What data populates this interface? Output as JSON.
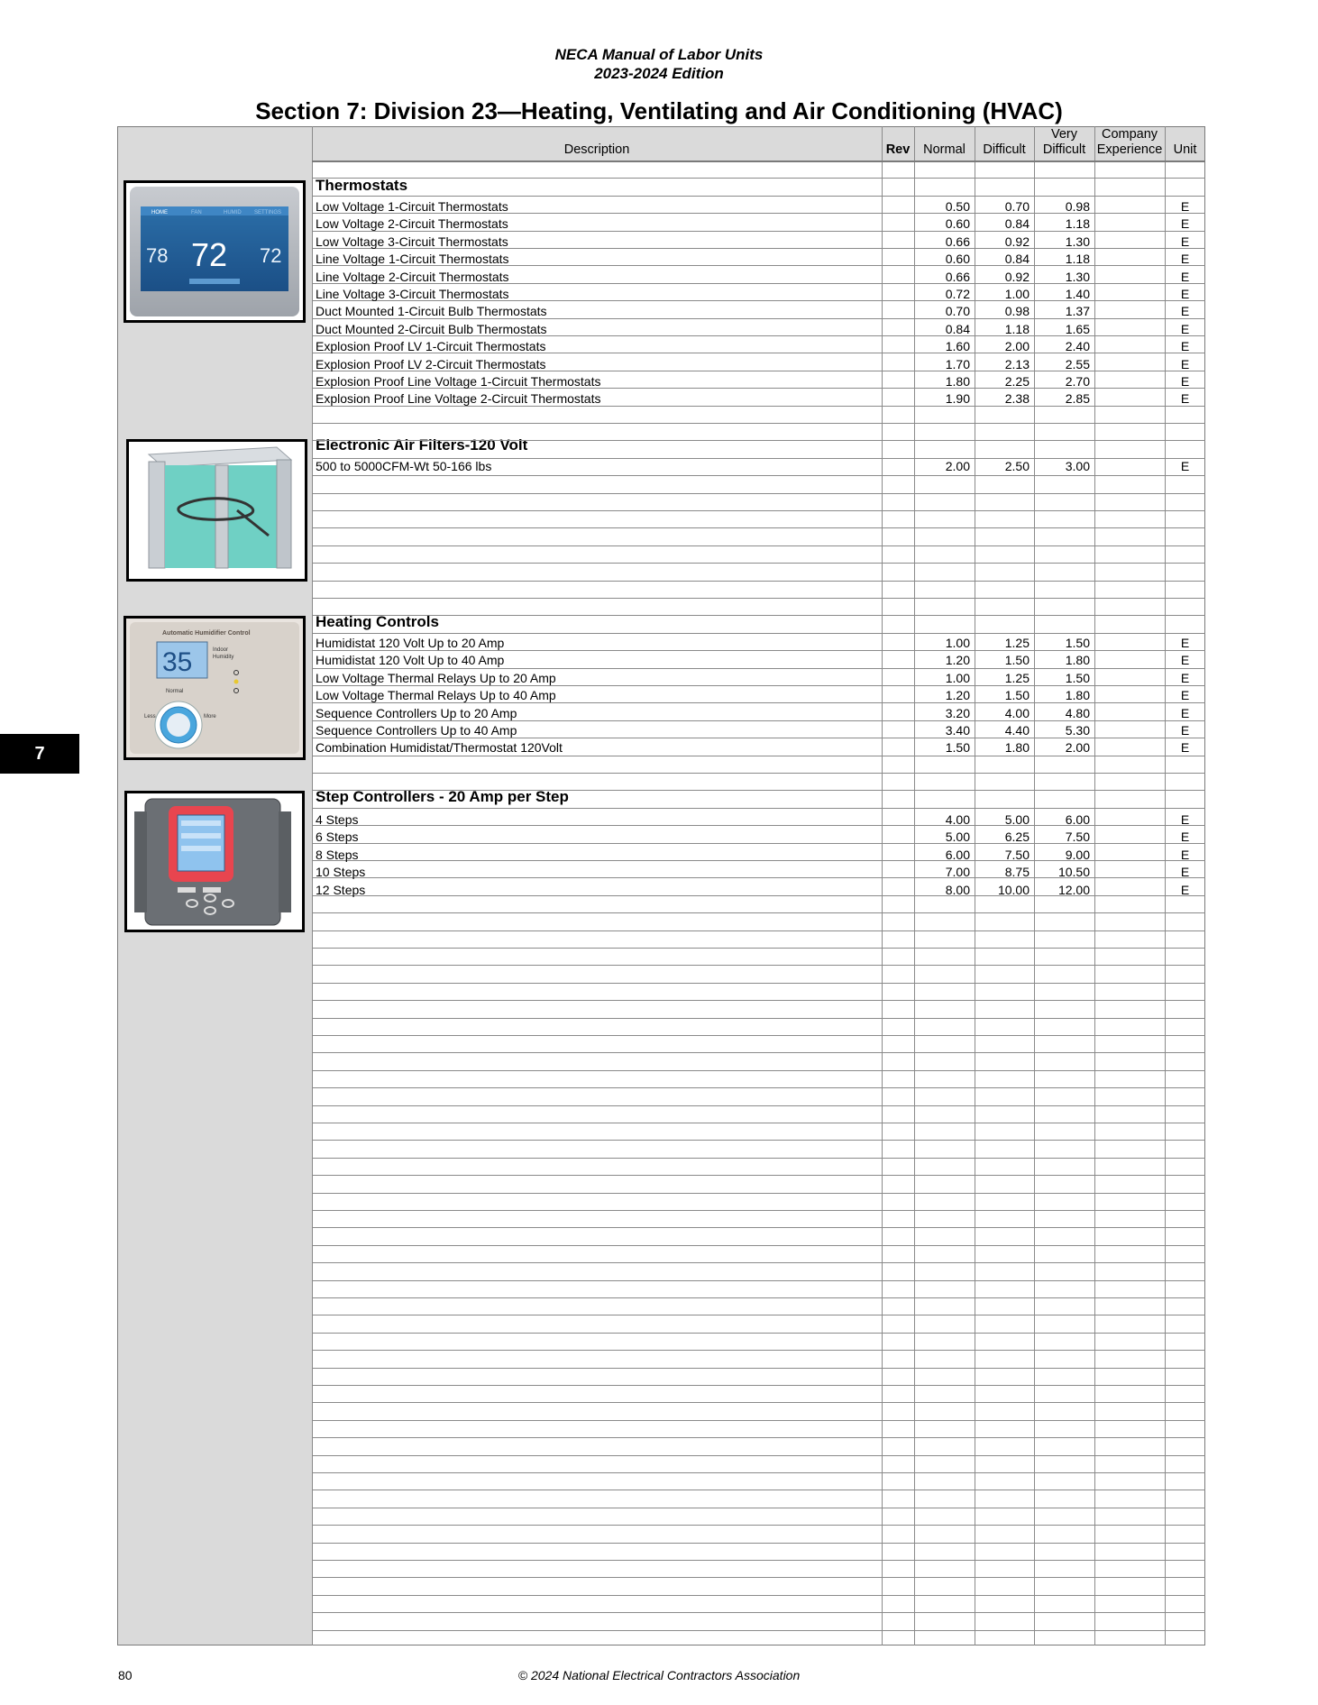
{
  "header": {
    "line1": "NECA Manual of Labor Units",
    "line2": "2023-2024 Edition",
    "section_title": "Section 7: Division 23—Heating, Ventilating and Air Conditioning (HVAC)"
  },
  "columns": {
    "description": "Description",
    "rev": "Rev",
    "normal": "Normal",
    "difficult": "Difficult",
    "very_difficult_1": "Very",
    "very_difficult_2": "Difficult",
    "company_1": "Company",
    "company_2": "Experience",
    "unit": "Unit"
  },
  "sections": [
    {
      "title": "Thermostats",
      "image": "thermostat-image",
      "items": [
        {
          "desc": "Low Voltage 1-Circuit Thermostats",
          "normal": "0.50",
          "difficult": "0.70",
          "very_difficult": "0.98",
          "unit": "E"
        },
        {
          "desc": "Low Voltage 2-Circuit Thermostats",
          "normal": "0.60",
          "difficult": "0.84",
          "very_difficult": "1.18",
          "unit": "E"
        },
        {
          "desc": "Low Voltage 3-Circuit Thermostats",
          "normal": "0.66",
          "difficult": "0.92",
          "very_difficult": "1.30",
          "unit": "E"
        },
        {
          "desc": "Line Voltage 1-Circuit Thermostats",
          "normal": "0.60",
          "difficult": "0.84",
          "very_difficult": "1.18",
          "unit": "E"
        },
        {
          "desc": "Line Voltage 2-Circuit Thermostats",
          "normal": "0.66",
          "difficult": "0.92",
          "very_difficult": "1.30",
          "unit": "E"
        },
        {
          "desc": "Line Voltage 3-Circuit Thermostats",
          "normal": "0.72",
          "difficult": "1.00",
          "very_difficult": "1.40",
          "unit": "E"
        },
        {
          "desc": "Duct Mounted 1-Circuit Bulb Thermostats",
          "normal": "0.70",
          "difficult": "0.98",
          "very_difficult": "1.37",
          "unit": "E"
        },
        {
          "desc": "Duct Mounted 2-Circuit Bulb Thermostats",
          "normal": "0.84",
          "difficult": "1.18",
          "very_difficult": "1.65",
          "unit": "E"
        },
        {
          "desc": "Explosion Proof LV 1-Circuit Thermostats",
          "normal": "1.60",
          "difficult": "2.00",
          "very_difficult": "2.40",
          "unit": "E"
        },
        {
          "desc": "Explosion Proof LV 2-Circuit Thermostats",
          "normal": "1.70",
          "difficult": "2.13",
          "very_difficult": "2.55",
          "unit": "E"
        },
        {
          "desc": "Explosion Proof Line Voltage 1-Circuit Thermostats",
          "normal": "1.80",
          "difficult": "2.25",
          "very_difficult": "2.70",
          "unit": "E"
        },
        {
          "desc": "Explosion Proof Line Voltage 2-Circuit Thermostats",
          "normal": "1.90",
          "difficult": "2.38",
          "very_difficult": "2.85",
          "unit": "E"
        }
      ]
    },
    {
      "title": "Electronic Air Filters-120 Volt",
      "image": "air-filter-image",
      "items": [
        {
          "desc": "500 to 5000CFM-Wt 50-166 lbs",
          "normal": "2.00",
          "difficult": "2.50",
          "very_difficult": "3.00",
          "unit": "E"
        }
      ]
    },
    {
      "title": "Heating Controls",
      "image": "humidifier-control-image",
      "items": [
        {
          "desc": "Humidistat 120 Volt Up to 20 Amp",
          "normal": "1.00",
          "difficult": "1.25",
          "very_difficult": "1.50",
          "unit": "E"
        },
        {
          "desc": "Humidistat 120 Volt Up to 40 Amp",
          "normal": "1.20",
          "difficult": "1.50",
          "very_difficult": "1.80",
          "unit": "E"
        },
        {
          "desc": "Low Voltage Thermal Relays Up to 20 Amp",
          "normal": "1.00",
          "difficult": "1.25",
          "very_difficult": "1.50",
          "unit": "E"
        },
        {
          "desc": "Low Voltage Thermal Relays Up to 40 Amp",
          "normal": "1.20",
          "difficult": "1.50",
          "very_difficult": "1.80",
          "unit": "E"
        },
        {
          "desc": "Sequence Controllers Up to 20 Amp",
          "normal": "3.20",
          "difficult": "4.00",
          "very_difficult": "4.80",
          "unit": "E"
        },
        {
          "desc": "Sequence Controllers Up to 40 Amp",
          "normal": "3.40",
          "difficult": "4.40",
          "very_difficult": "5.30",
          "unit": "E"
        },
        {
          "desc": "Combination Humidistat/Thermostat 120Volt",
          "normal": "1.50",
          "difficult": "1.80",
          "very_difficult": "2.00",
          "unit": "E"
        }
      ]
    },
    {
      "title": "Step Controllers - 20 Amp per Step",
      "image": "step-controller-image",
      "items": [
        {
          "desc": "4 Steps",
          "normal": "4.00",
          "difficult": "5.00",
          "very_difficult": "6.00",
          "unit": "E"
        },
        {
          "desc": "6 Steps",
          "normal": "5.00",
          "difficult": "6.25",
          "very_difficult": "7.50",
          "unit": "E"
        },
        {
          "desc": "8 Steps",
          "normal": "6.00",
          "difficult": "7.50",
          "very_difficult": "9.00",
          "unit": "E"
        },
        {
          "desc": "10 Steps",
          "normal": "7.00",
          "difficult": "8.75",
          "very_difficult": "10.50",
          "unit": "E"
        },
        {
          "desc": "12 Steps",
          "normal": "8.00",
          "difficult": "10.00",
          "very_difficult": "12.00",
          "unit": "E"
        }
      ]
    }
  ],
  "images": {
    "thermostat": {
      "tab1": "HOME",
      "tab2": "FAN",
      "tab3": "HUMID",
      "tab4": "SETTINGS",
      "inside": "72",
      "outside": "78",
      "set": "72"
    },
    "humidifier": {
      "title": "Automatic Humidifier Control",
      "reading": "35",
      "label1": "Indoor",
      "label2": "Humidity",
      "less": "Less",
      "more": "More",
      "normal": "Normal"
    }
  },
  "side_tab": "7",
  "footer": {
    "page_number": "80",
    "copyright": "© 2024 National Electrical Contractors Association"
  }
}
